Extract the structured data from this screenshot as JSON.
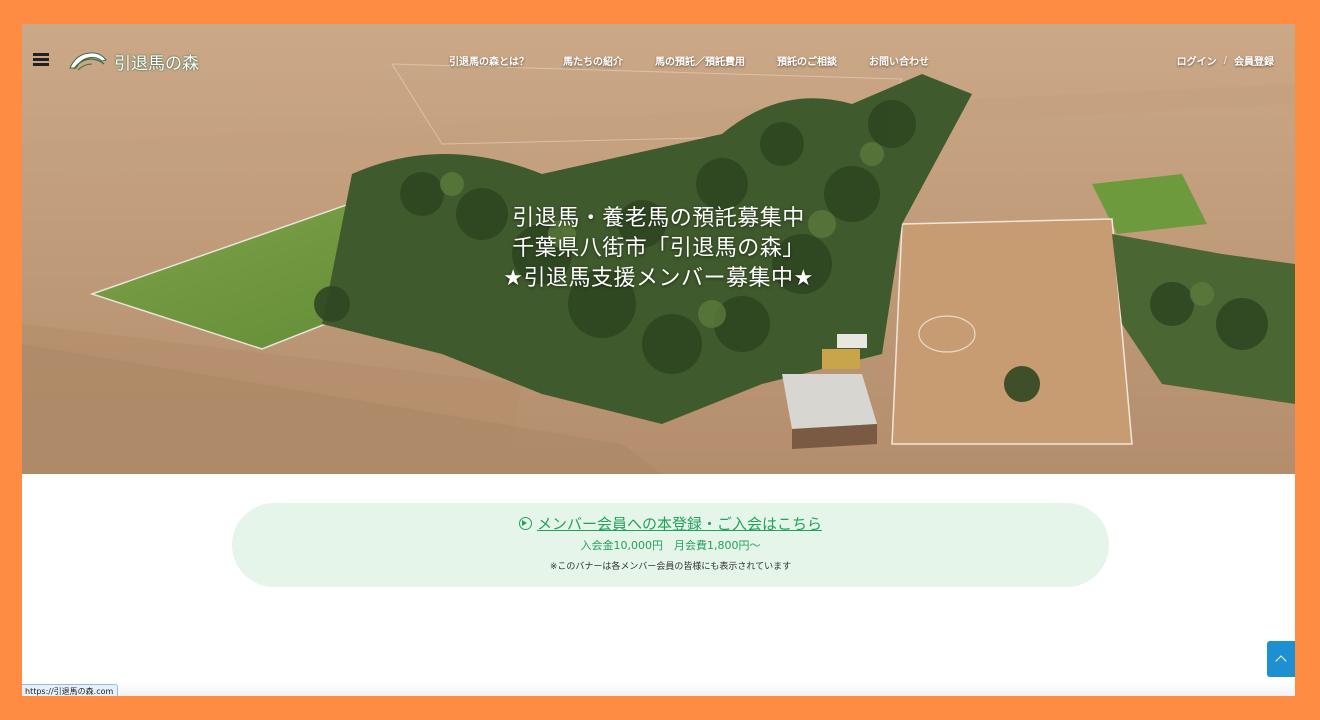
{
  "site": {
    "logo_text": "引退馬の森"
  },
  "nav": {
    "items": [
      "引退馬の森とは？",
      "馬たちの紹介",
      "馬の預託／預託費用",
      "預託のご相談",
      "お問い合わせ"
    ]
  },
  "auth": {
    "login": "ログイン",
    "separator": "/",
    "register": "会員登録"
  },
  "hero": {
    "line1": "引退馬・養老馬の預託募集中",
    "line2": "千葉県八街市「引退馬の森」",
    "line3": "★引退馬支援メンバー募集中★"
  },
  "banner": {
    "link_text": "メンバー会員への本登録・ご入会はこちら",
    "fee_text": "入会金10,000円　月会費1,800円〜",
    "note_text": "※このバナーは各メンバー会員の皆様にも表示されています"
  },
  "status_bar": {
    "url": "https://引退馬の森.com"
  },
  "colors": {
    "accent_green": "#23a15a",
    "banner_bg": "#e5f5ea",
    "to_top_blue": "#1e8fd0",
    "frame_orange": "#ff8c42"
  }
}
